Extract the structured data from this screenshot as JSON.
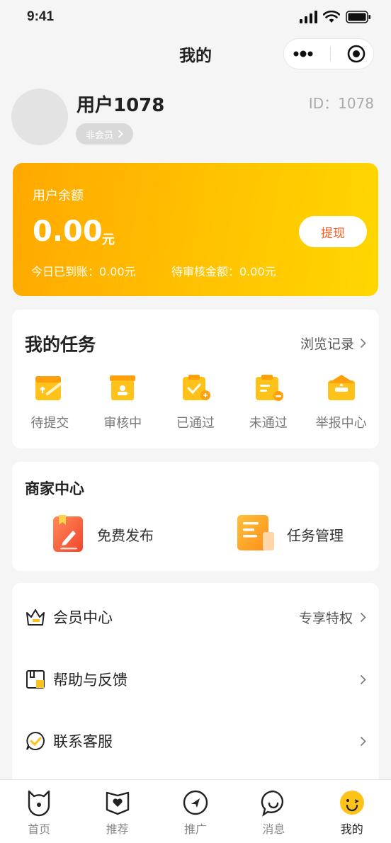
{
  "status_bar": {
    "time": "9:41"
  },
  "nav": {
    "title": "我的"
  },
  "profile": {
    "username": "用户1078",
    "member_status": "非会员",
    "user_id": "ID：1078"
  },
  "balance": {
    "label": "用户余额",
    "amount": "0.00",
    "unit": "元",
    "withdraw_label": "提现",
    "today_received": "今日已到账：0.00元",
    "pending_amount": "待审核金额：0.00元"
  },
  "tasks": {
    "title": "我的任务",
    "history_label": "浏览记录",
    "items": [
      {
        "label": "待提交",
        "icon": "pending-submit-icon"
      },
      {
        "label": "审核中",
        "icon": "reviewing-icon"
      },
      {
        "label": "已通过",
        "icon": "approved-icon"
      },
      {
        "label": "未通过",
        "icon": "rejected-icon"
      },
      {
        "label": "举报中心",
        "icon": "report-center-icon"
      }
    ]
  },
  "merchant": {
    "title": "商家中心",
    "items": [
      {
        "label": "免费发布",
        "icon": "publish-icon"
      },
      {
        "label": "任务管理",
        "icon": "task-manage-icon"
      }
    ]
  },
  "menu": {
    "items": [
      {
        "label": "会员中心",
        "extra": "专享特权",
        "icon": "crown-icon"
      },
      {
        "label": "帮助与反馈",
        "extra": "",
        "icon": "help-icon"
      },
      {
        "label": "联系客服",
        "extra": "",
        "icon": "service-icon"
      }
    ]
  },
  "tab_bar": {
    "items": [
      {
        "label": "首页",
        "icon": "home-cat-icon"
      },
      {
        "label": "推荐",
        "icon": "recommend-heart-icon"
      },
      {
        "label": "推广",
        "icon": "promote-send-icon"
      },
      {
        "label": "消息",
        "icon": "message-icon"
      },
      {
        "label": "我的",
        "icon": "mine-smile-icon"
      }
    ],
    "active_index": 4
  },
  "colors": {
    "accent": "#ffc300",
    "accent_dark": "#ffa800",
    "withdraw_text": "#ff5a1f",
    "background": "#f5f5f5"
  }
}
